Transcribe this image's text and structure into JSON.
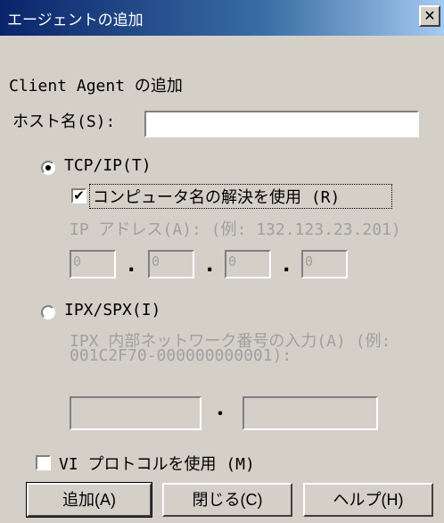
{
  "window": {
    "title": "エージェントの追加",
    "close_glyph": "✕"
  },
  "heading": "Client Agent の追加",
  "host": {
    "label": "ホスト名(S):",
    "value": ""
  },
  "tcp": {
    "label": "TCP/IP(T)",
    "selected": true
  },
  "resolve": {
    "label": "コンピュータ名の解決を使用 (R)",
    "checked": true,
    "check_glyph": "✔"
  },
  "ip": {
    "label": "IP アドレス(A): (例: 132.123.23.201)",
    "octets": [
      "0",
      "0",
      "0",
      "0"
    ],
    "separator": "."
  },
  "ipx": {
    "label": "IPX/SPX(I)",
    "selected": false,
    "hint_line1": "IPX 内部ネットワーク番号の入力(A) (例:",
    "hint_line2": "001C2F70-000000000001):",
    "separator": "・"
  },
  "vi": {
    "label": "VI プロトコルを使用 (M)",
    "checked": false
  },
  "buttons": {
    "add": "追加(A)",
    "close": "閉じる(C)",
    "help": "ヘルプ(H)"
  }
}
